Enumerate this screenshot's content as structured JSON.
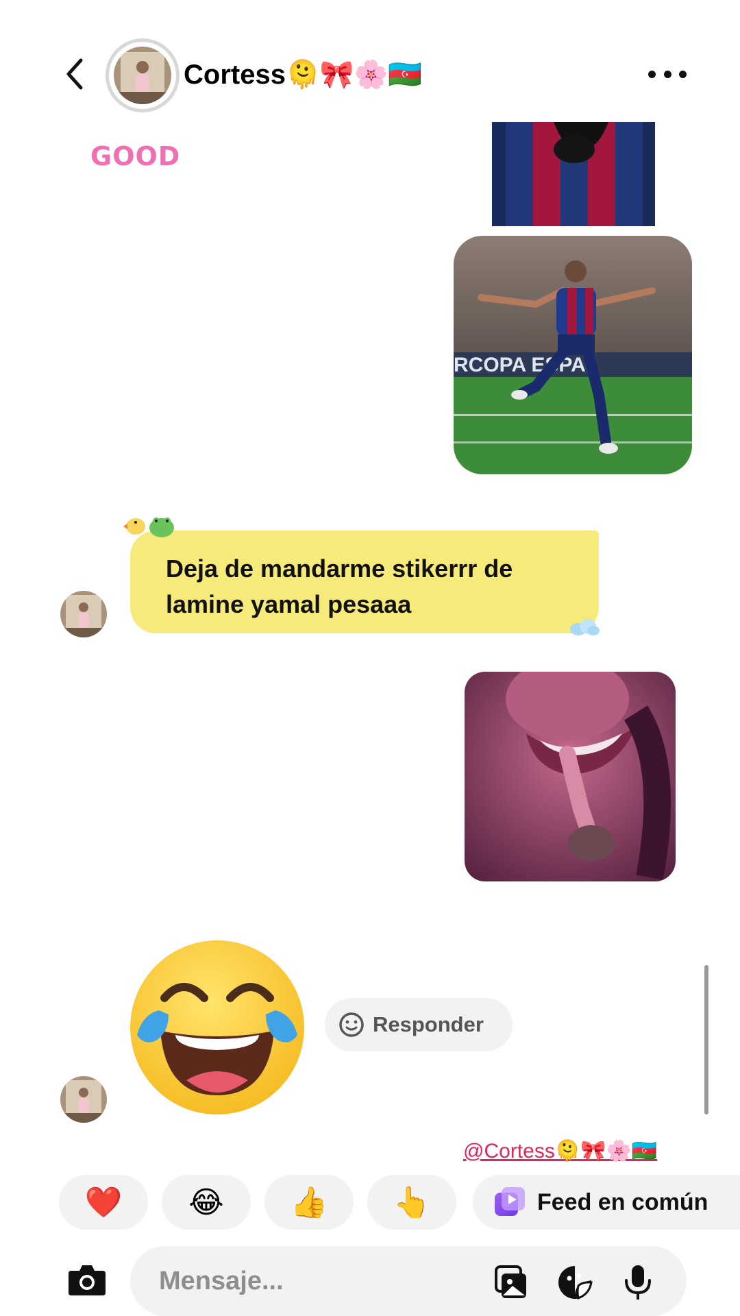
{
  "header": {
    "contact_name": "Cortess🫠🎀🌸🇦🇿",
    "back_icon": "chevron-left-icon",
    "more_icon": "more-horizontal-icon"
  },
  "messages": {
    "sticker_good": "GOOD",
    "received_text": "Deja de mandarme stikerrr de lamine yamal pesaaa",
    "laugh_emoji": "😂",
    "reply_label": "Responder"
  },
  "mention": "@Cortess🫠🎀🌸🇦🇿",
  "quick_reactions": [
    {
      "emoji": "❤️"
    },
    {
      "emoji": "😂"
    },
    {
      "emoji": "👍"
    },
    {
      "emoji": "👆"
    }
  ],
  "feed_chip": {
    "label": "Feed en común"
  },
  "composer": {
    "placeholder": "Mensaje...",
    "value": ""
  },
  "colors": {
    "bubble_received": "#f6ea7a",
    "sticker_pink": "#f06fb3",
    "mention_red": "#e0245e",
    "chip_bg": "#f2f2f2"
  }
}
